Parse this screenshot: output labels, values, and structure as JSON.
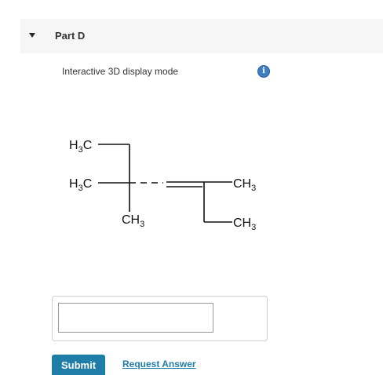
{
  "part": {
    "title": "Part D",
    "mode_label": "Interactive 3D display mode",
    "info_glyph": "i"
  },
  "molecule": {
    "labels": {
      "top_left": [
        "H",
        "3",
        "C"
      ],
      "mid_left": [
        "H",
        "3",
        "C"
      ],
      "bottom": [
        "CH",
        "3"
      ],
      "right_top": [
        "CH",
        "3"
      ],
      "right_bottom": [
        "CH",
        "3"
      ]
    }
  },
  "answer": {
    "value": "",
    "placeholder": ""
  },
  "actions": {
    "submit_label": "Submit",
    "request_label": "Request Answer"
  },
  "colors": {
    "header_bg": "#f6f6f6",
    "accent": "#1f7ea8",
    "info_icon": "#3d7fc1"
  }
}
